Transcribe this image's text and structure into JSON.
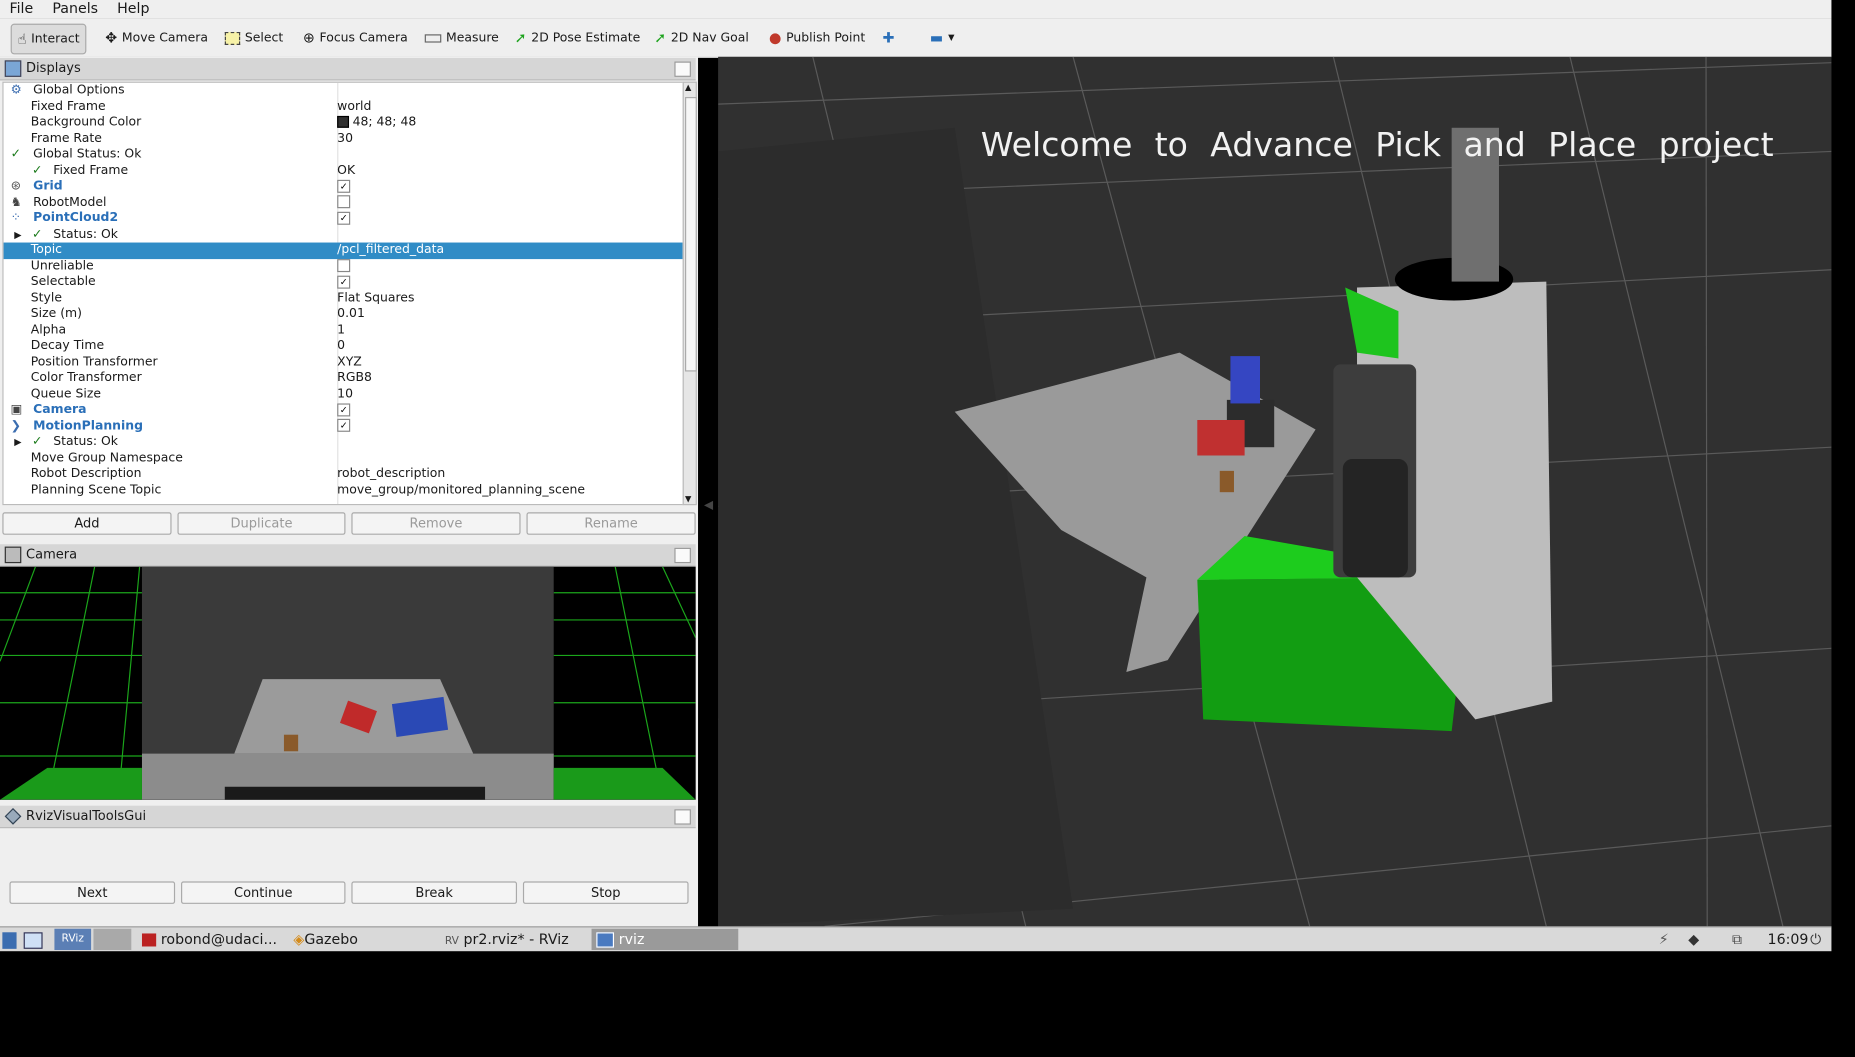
{
  "menubar": {
    "items": [
      "File",
      "Panels",
      "Help"
    ]
  },
  "toolbar": {
    "tools": [
      {
        "label": "Interact",
        "icon": "hand-icon"
      },
      {
        "label": "Move Camera",
        "icon": "move-icon"
      },
      {
        "label": "Select",
        "icon": "select-icon"
      },
      {
        "label": "Focus Camera",
        "icon": "focus-icon"
      },
      {
        "label": "Measure",
        "icon": "ruler-icon"
      },
      {
        "label": "2D Pose Estimate",
        "icon": "green-arrow-icon"
      },
      {
        "label": "2D Nav Goal",
        "icon": "green-arrow-icon"
      },
      {
        "label": "Publish Point",
        "icon": "map-pin-icon"
      }
    ]
  },
  "displays": {
    "title": "Displays",
    "rows": [
      {
        "key": "Global Options",
        "value": ""
      },
      {
        "key": "Fixed Frame",
        "value": "world"
      },
      {
        "key": "Background Color",
        "value": "48; 48; 48"
      },
      {
        "key": "Frame Rate",
        "value": "30"
      },
      {
        "key": "Global Status: Ok",
        "value": ""
      },
      {
        "key": "Fixed Frame",
        "value": "OK"
      },
      {
        "key": "Grid",
        "value": ""
      },
      {
        "key": "RobotModel",
        "value": ""
      },
      {
        "key": "PointCloud2",
        "value": ""
      },
      {
        "key": "Status: Ok",
        "value": ""
      },
      {
        "key": "Topic",
        "value": "/pcl_filtered_data"
      },
      {
        "key": "Unreliable",
        "value": ""
      },
      {
        "key": "Selectable",
        "value": ""
      },
      {
        "key": "Style",
        "value": "Flat Squares"
      },
      {
        "key": "Size (m)",
        "value": "0.01"
      },
      {
        "key": "Alpha",
        "value": "1"
      },
      {
        "key": "Decay Time",
        "value": "0"
      },
      {
        "key": "Position Transformer",
        "value": "XYZ"
      },
      {
        "key": "Color Transformer",
        "value": "RGB8"
      },
      {
        "key": "Queue Size",
        "value": "10"
      },
      {
        "key": "Camera",
        "value": ""
      },
      {
        "key": "MotionPlanning",
        "value": ""
      },
      {
        "key": "Status: Ok",
        "value": ""
      },
      {
        "key": "Move Group Namespace",
        "value": ""
      },
      {
        "key": "Robot Description",
        "value": "robot_description"
      },
      {
        "key": "Planning Scene Topic",
        "value": "move_group/monitored_planning_scene"
      }
    ],
    "buttons": {
      "add": "Add",
      "duplicate": "Duplicate",
      "remove": "Remove",
      "rename": "Rename"
    }
  },
  "camera_panel": {
    "title": "Camera"
  },
  "rviz_tools": {
    "title": "RvizVisualToolsGui",
    "buttons": {
      "next": "Next",
      "continue": "Continue",
      "break": "Break",
      "stop": "Stop"
    }
  },
  "view3d": {
    "overlay_text": "Welcome to Advance Pick and Place project"
  },
  "taskbar": {
    "terminal": "robond@udaci...",
    "gazebo": "Gazebo",
    "rviz_window": "pr2.rviz* - RViz",
    "rviz_task": "rviz",
    "clock": "16:09",
    "rviz_badge": "RViz"
  },
  "colors": {
    "selection": "#308cc6",
    "background_3d": "#303030",
    "link_blue": "#2a6fb8"
  }
}
